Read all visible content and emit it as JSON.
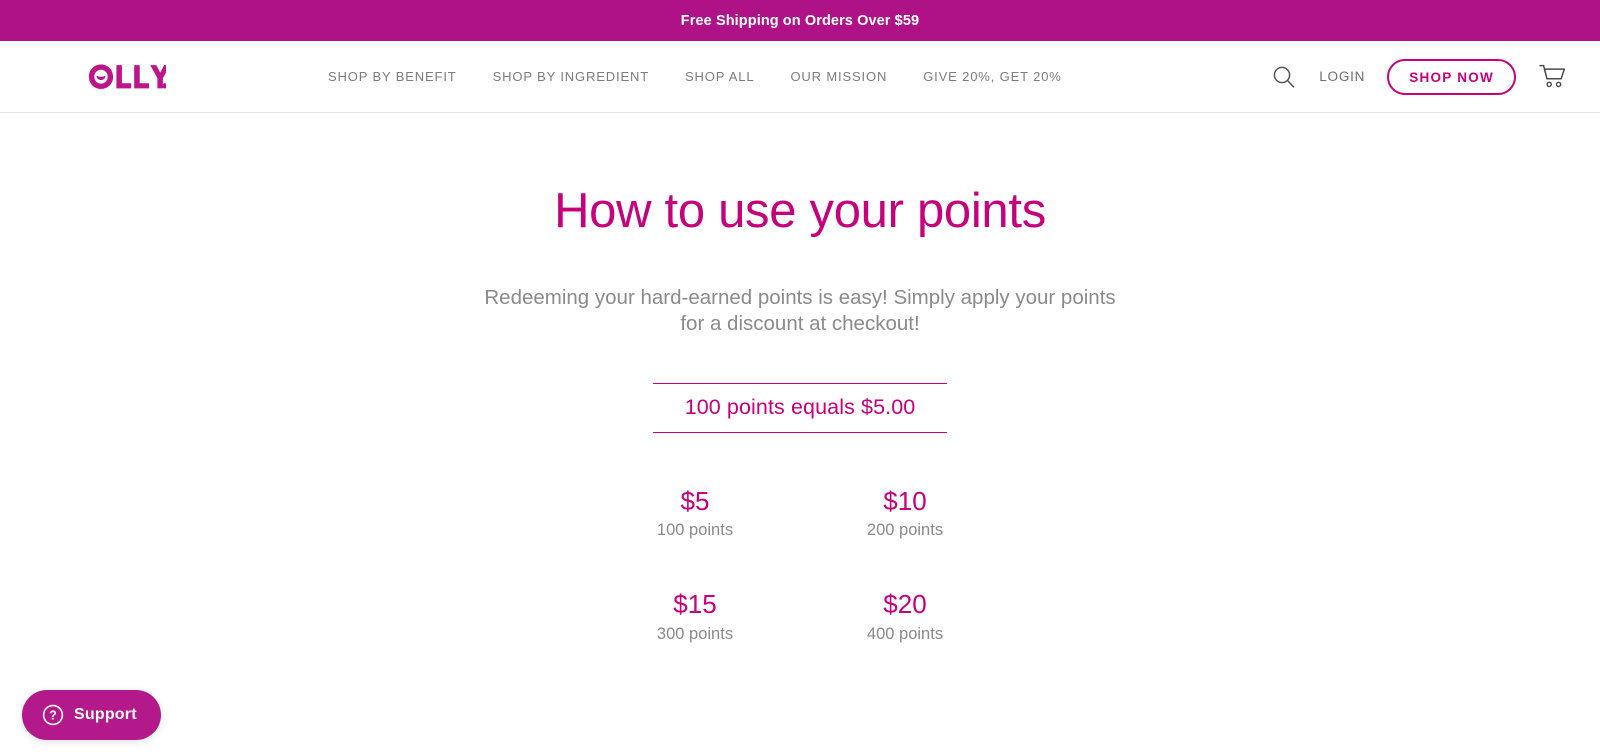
{
  "promo_banner": {
    "text_strong": "Free Shipping",
    "text_rest": "on Orders Over $59",
    "background_color": "#ae1286"
  },
  "header": {
    "logo_text": "OLLY.",
    "nav_items": [
      {
        "label": "SHOP BY BENEFIT"
      },
      {
        "label": "SHOP BY INGREDIENT"
      },
      {
        "label": "SHOP ALL"
      },
      {
        "label": "OUR MISSION"
      },
      {
        "label": "GIVE 20%, GET 20%"
      }
    ],
    "search_icon": "search-icon",
    "login_label": "LOGIN",
    "shop_now_label": "SHOP NOW",
    "cart_icon": "shopping-cart-icon",
    "cart_count": ""
  },
  "main": {
    "title": "How to use your points",
    "subtitle": "Redeeming your hard-earned points is easy! Simply apply your points for a discount at checkout!",
    "conversion_rate": "100 points equals $5.00",
    "tiers": [
      {
        "amount": "$5",
        "points": "100 points"
      },
      {
        "amount": "$10",
        "points": "200 points"
      },
      {
        "amount": "$15",
        "points": "300 points"
      },
      {
        "amount": "$20",
        "points": "400 points"
      }
    ]
  },
  "support_widget": {
    "label": "Support",
    "icon": "question-mark-circle-icon",
    "background_color": "#b4198c"
  },
  "colors": {
    "brand_magenta": "#c4007b",
    "banner_magenta": "#ae1286",
    "body_gray": "#8b8b8b",
    "nav_gray": "#7d7d7d"
  }
}
